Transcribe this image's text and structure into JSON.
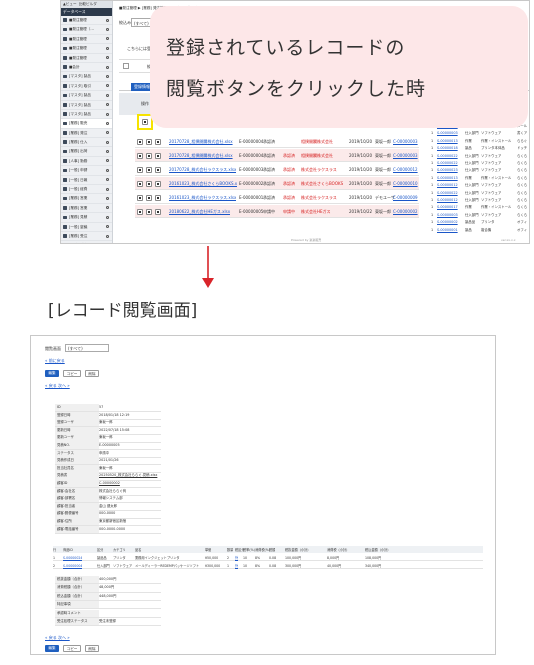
{
  "callout": {
    "line1": "登録されているレコードの",
    "line2": "閲覧ボタンをクリックした時"
  },
  "section_title": "[レコード閲覧画面]",
  "list_screen": {
    "sidebar_header_tabs": [
      "▲ビュー",
      "比較ビルダ"
    ],
    "sidebar_title": "データベース",
    "sidebar_items": [
      "■発注管理",
      "■発注管理（…",
      "■発注管理",
      "■発注管理",
      "■発注管理",
      "■会計",
      "[マスタ] 製品",
      "[マスタ] 取引",
      "[マスタ] 製品",
      "[マスタ] 製品",
      "[マスタ] 製品",
      "[業務] 販売",
      "[業務] 発注",
      "[業務] 仕入",
      "[業務] 出荷",
      "[人事] 勤務",
      "[一般] 申請",
      "[一般] 日報",
      "[一般] 経費",
      "[業務] 営業",
      "[業務] 営業",
      "[業務] 見積",
      "[一般] 稟議",
      "[業務] 受注",
      "[業務] 受注",
      "[業務] 売上",
      "[集計] 売上"
    ],
    "breadcrumb": "■発注管理 ▶ [業務] 発注管理 ▶ [一般] 見積一覧",
    "search_label": "絞込み",
    "search_select": "(すべて)",
    "search_label2": "一覧表示",
    "info_text": "こちらには登録された見積が全て表示されています",
    "filter_label": "絞込条件",
    "filter_value": "-10 [取扱] 見積書",
    "tabs": [
      "登録情報",
      "表示件数",
      "100件"
    ],
    "column_headers": [
      "操作",
      "見"
    ],
    "rows": [
      {
        "date": "20250520",
        "file": "見積書株式会社ららぐ.xlsx",
        "code": "",
        "person": "",
        "status": "",
        "company": "",
        "date2": "",
        "staff": "",
        "cust": "",
        "highlight": true
      },
      {
        "date": "",
        "file": "20170728_相撲開闢株式会社.xlsx",
        "code": "E-00000004",
        "person": "承認済",
        "status": "",
        "company": "相撲開闢株式会社",
        "date2": "2019/10/20",
        "staff": "東坂一郎",
        "cust": "C-00000003"
      },
      {
        "date": "",
        "file": "20170728_相撲開闢株式会社.xlsx",
        "code": "E-00000004",
        "person": "承認済",
        "status": "承認済",
        "company": "相撲開闢株式会社",
        "date2": "2019/10/20",
        "staff": "東坂一郎",
        "cust": "C-00000003"
      },
      {
        "date": "",
        "file": "20170728_株式会社ラクスラス.xlsx",
        "code": "E-00000003",
        "person": "承認済",
        "status": "承認済",
        "company": "株式会社ラクスラス",
        "date2": "2019/10/20",
        "staff": "東坂一郎",
        "cust": "C-00000012"
      },
      {
        "date": "",
        "file": "20161023_株式会社さくらBOOKS.xlsx",
        "code": "E-00000002",
        "person": "承認済",
        "status": "承認済",
        "company": "株式会社さくらBOOKS",
        "date2": "2019/10/20",
        "staff": "東坂一郎",
        "cust": "C-00000010"
      },
      {
        "date": "",
        "file": "20161023_株式会社ラクスラス.xlsx",
        "code": "E-00000001",
        "person": "承認済",
        "status": "承認済",
        "company": "株式会社ラクスラス",
        "date2": "2019/10/20",
        "staff": "デモユーザ",
        "cust": "C-00000009"
      },
      {
        "date": "",
        "file": "20180622_株式会社HEガス.xlsx",
        "code": "E-00000005",
        "person": "申請中",
        "status": "申請中",
        "company": "株式会社HEガス",
        "date2": "2019/10/22",
        "staff": "東坂一郎",
        "cust": "C-00000002"
      }
    ],
    "right_rows": [
      [
        "1",
        "S-00000001",
        "仕入部門",
        "ソフトウェア",
        "メール"
      ],
      [
        "1",
        "S-00000003",
        "仕入部門",
        "ソフトウェア",
        "書くア"
      ],
      [
        "1",
        "S-00000013",
        "作業",
        "作業・インストール",
        "ららぐ"
      ],
      [
        "1",
        "S-00000018",
        "製品",
        "プリンタ本体品",
        "ドッチ"
      ],
      [
        "1",
        "S-00000022",
        "仕入部門",
        "ソフトウェア",
        "らくら"
      ],
      [
        "1",
        "S-00000022",
        "仕入部門",
        "ソフトウェア",
        "らくら"
      ],
      [
        "1",
        "S-00000023",
        "仕入部門",
        "ソフトウェア",
        "らくら"
      ],
      [
        "1",
        "S-00000013",
        "作業",
        "作業・インストール",
        "らくら"
      ],
      [
        "1",
        "S-00000012",
        "仕入部門",
        "ソフトウェア",
        "らくら"
      ],
      [
        "1",
        "S-00000022",
        "仕入部門",
        "ソフトウェア",
        "らくら"
      ],
      [
        "1",
        "S-00000012",
        "仕入部門",
        "ソフトウェア",
        "らくら"
      ],
      [
        "1",
        "S-00000017",
        "作業",
        "作業・インストール",
        "らくら"
      ],
      [
        "1",
        "S-00000003",
        "仕入部門",
        "ソフトウェア",
        "らくら"
      ],
      [
        "1",
        "S-00000002",
        "製品品",
        "プリンタ",
        "オフィ"
      ],
      [
        "1",
        "S-00000001",
        "製品",
        "複合機",
        "オフィ"
      ]
    ],
    "footer": "Powered by 楽楽販売",
    "version": "ver.xx.x.x"
  },
  "view_screen": {
    "display_label": "閲覧画面",
    "display_select": "(すべて)",
    "back_link": "« 前に戻る",
    "buttons": [
      "編集",
      "コピー",
      "削除"
    ],
    "nav": "« 戻る 次へ »",
    "fields": [
      {
        "key": "ID",
        "value": "57"
      },
      {
        "key": "登録日時",
        "value": "2018/01/18 12:19"
      },
      {
        "key": "登録ユーザ",
        "value": "東坂一郎"
      },
      {
        "key": "更新日時",
        "value": "2022/07/18 15:08"
      },
      {
        "key": "更新ユーザ",
        "value": "東坂一郎"
      },
      {
        "key": "見積NO.",
        "value": "E-00000005"
      },
      {
        "key": "ステータス",
        "value": "申請中"
      },
      {
        "key": "見積作成日",
        "value": "2021/01/26"
      },
      {
        "key": "担当社員名",
        "value": "東坂一郎"
      },
      {
        "key": "見積書",
        "value": "20250520_株式会社ららぐ.見積.xlsx"
      },
      {
        "key": "顧客ID",
        "value": "C-00000002"
      },
      {
        "key": "顧客:会社名",
        "value": "株式会社ららぐ商"
      },
      {
        "key": "顧客:部署名",
        "value": "情報システム部"
      },
      {
        "key": "顧客:担当者",
        "value": "金山 健太郎"
      },
      {
        "key": "顧客:郵便番号",
        "value": "000-0000"
      },
      {
        "key": "顧客:住所",
        "value": "東京都新宿区新宿"
      },
      {
        "key": "顧客:電話番号",
        "value": "000-0000-0000"
      }
    ],
    "detail_headers": [
      "行",
      "商品ID",
      "区分",
      "カテゴリ",
      "品名",
      "単価",
      "数量",
      "税区分",
      "税率(%)",
      "消費税(%)",
      "税額",
      "税抜金額（小計）",
      "消費税（小計）",
      "税込金額（小計）"
    ],
    "detail_rows": [
      [
        "1",
        "S-00000024",
        "製品品",
        "プリンタ",
        "業務用インクジェットプリンタ",
        "¥50,000",
        "2",
        "外",
        "10",
        "8%",
        "0.08",
        "100,000円",
        "8,000円",
        "108,000円"
      ],
      [
        "2",
        "S-00000004",
        "仕入部門",
        "ソフトウェア",
        "メールディーラーREDEMPパッケージソフト",
        "¥300,000",
        "1",
        "外",
        "10",
        "8%",
        "0.08",
        "300,000円",
        "40,000円",
        "340,000円"
      ]
    ],
    "summary": [
      {
        "key": "税抜金額（合計）",
        "value": "400,000円"
      },
      {
        "key": "消費税額（合計）",
        "value": "48,000円"
      },
      {
        "key": "税込金額（合計）",
        "value": "448,000円"
      },
      {
        "key": "特記事項",
        "value": ""
      },
      {
        "key": "承認時コメント",
        "value": ""
      },
      {
        "key": "受注処理ステータス",
        "value": "受注未登録"
      }
    ],
    "nav_bottom": "« 戻る 次へ »"
  },
  "colors": {
    "accent_blue": "#1f5fbf",
    "callout_pink": "#fde7e8",
    "arrow_red": "#d9242a",
    "highlight_yellow": "#f6e300"
  }
}
